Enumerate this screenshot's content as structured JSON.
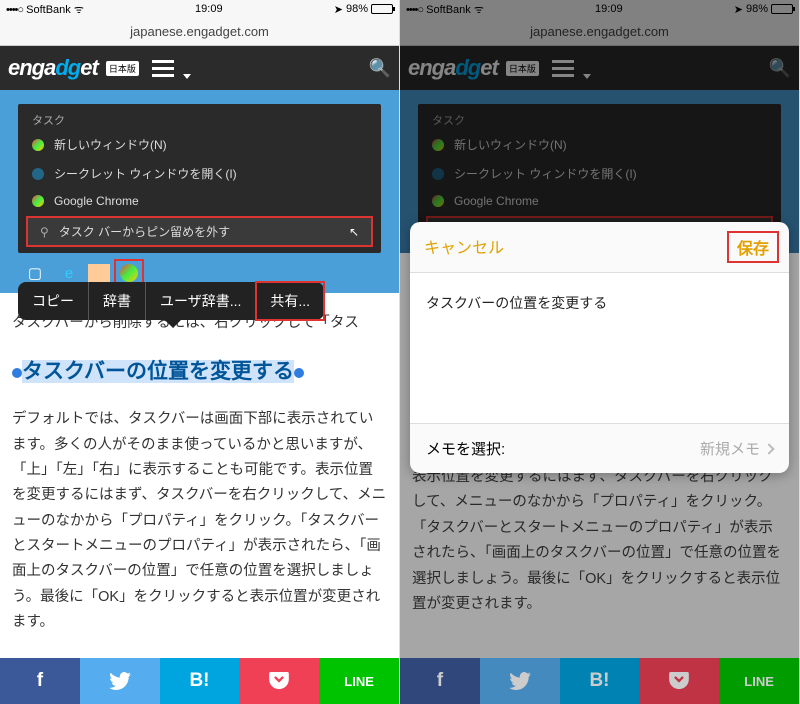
{
  "status": {
    "carrier": "SoftBank",
    "time": "19:09",
    "battery": "98%",
    "signal": "••••○"
  },
  "url": "japanese.engadget.com",
  "brand": {
    "name": "engadget",
    "badge": "日本版"
  },
  "winshot": {
    "title": "タスク",
    "items": [
      "新しいウィンドウ(N)",
      "シークレット ウィンドウを開く(I)",
      "Google Chrome",
      "タスク バーからピン留めを外す"
    ]
  },
  "caption": "タスクバーから削除するには、右クリックして「タス",
  "popup": {
    "items": [
      "コピー",
      "辞書",
      "ユーザ辞書...",
      "共有..."
    ]
  },
  "headline": "タスクバーの位置を変更する",
  "body": "デフォルトでは、タスクバーは画面下部に表示されています。多くの人がそのまま使っているかと思いますが、「上」「左」「右」に表示することも可能です。表示位置を変更するにはまず、タスクバーを右クリックして、メニューのなかから「プロパティ」をクリック。「タスクバーとスタートメニューのプロパティ」が表示されたら、「画面上のタスクバーの位置」で任意の位置を選択しましょう。最後に「OK」をクリックすると表示位置が変更されます。",
  "body_right": "表示位置を変更するにはまず、タスクバーを右クリックして、メニューのなかから「プロパティ」をクリック。「タスクバーとスタートメニューのプロパティ」が表示されたら、「画面上のタスクバーの位置」で任意の位置を選択しましょう。最後に「OK」をクリックすると表示位置が変更されます。",
  "share": {
    "fb": "f",
    "tw": "t",
    "hb": "B!",
    "pk": "P",
    "ln": "LINE"
  },
  "sheet": {
    "cancel": "キャンセル",
    "save": "保存",
    "text": "タスクバーの位置を変更する",
    "memo_label": "メモを選択:",
    "memo_value": "新規メモ"
  }
}
